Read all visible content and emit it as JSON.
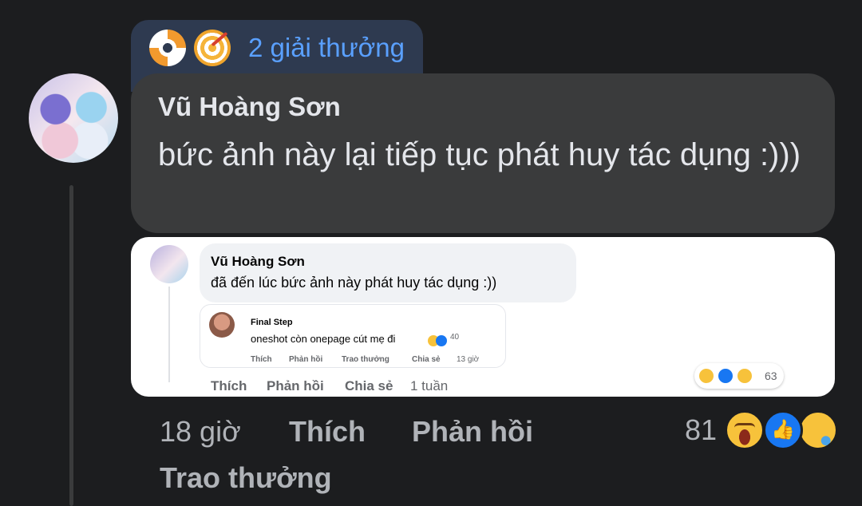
{
  "awards": {
    "label": "2 giải thưởng",
    "icons": [
      "lifebuoy-award-icon",
      "target-award-icon"
    ],
    "colors": {
      "background": "#2e3a50",
      "text": "#5aa0ff"
    }
  },
  "comment": {
    "author": "Vũ Hoàng Sơn",
    "text": "bức ảnh này lại tiếp tục phát huy tác dụng :)))",
    "time": "18 giờ",
    "like_label": "Thích",
    "reply_label": "Phản hồi",
    "award_label": "Trao thưởng",
    "reaction_count": "81",
    "reactions": [
      "haha-reaction-icon",
      "like-reaction-icon",
      "sad-reaction-icon"
    ]
  },
  "embedded": {
    "comment": {
      "author": "Vũ Hoàng Sơn",
      "text": "đã đến lúc bức ảnh này phát huy tác dụng :))",
      "like_label": "Thích",
      "reply_label": "Phản hồi",
      "share_label": "Chia sẻ",
      "time": "1 tuần",
      "reaction_count": "63"
    },
    "reply": {
      "author": "Final Step",
      "text": "oneshot còn onepage cút mẹ đi",
      "reaction_count": "40",
      "like_label": "Thích",
      "reply_label": "Phản hồi",
      "award_label": "Trao thưởng",
      "share_label": "Chia sẻ",
      "time": "13 giờ"
    }
  },
  "colors": {
    "page_background": "#1c1d1f",
    "bubble": "#3a3b3c",
    "primary_text": "#e4e6eb",
    "secondary_text": "#b0b3b8",
    "like_blue": "#1877f2"
  }
}
